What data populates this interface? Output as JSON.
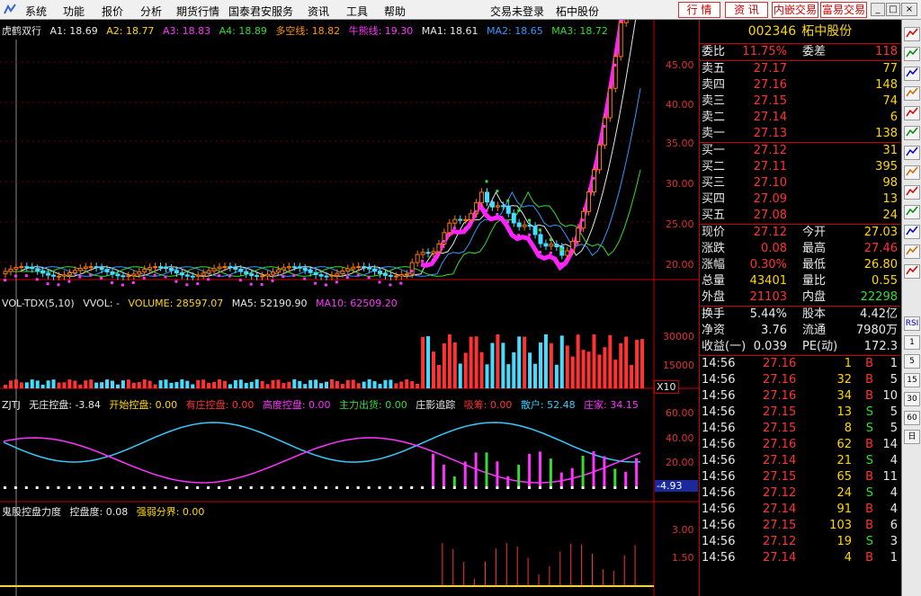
{
  "menu": {
    "items": [
      "系统",
      "功能",
      "报价",
      "分析",
      "期货行情",
      "国泰君安服务",
      "资讯",
      "工具",
      "帮助"
    ],
    "trade_status": "交易未登录",
    "stock_name": "柘中股份",
    "right_buttons": [
      "行 情",
      "资 讯",
      "内嵌交易",
      "富易交易"
    ],
    "window_buttons": [
      "_",
      "□",
      "×"
    ]
  },
  "chart": {
    "main_legend": {
      "title": "虎鹤双行",
      "items": [
        {
          "text": "A1: 18.69",
          "color": "#e8e8e8"
        },
        {
          "text": "A2: 18.77",
          "color": "#ffd800"
        },
        {
          "text": "A3: 18.83",
          "color": "#ff33ff"
        },
        {
          "text": "A4: 18.89",
          "color": "#33dd33"
        },
        {
          "text": "多空线: 18.82",
          "color": "#ff9900"
        },
        {
          "text": "牛熊线: 19.30",
          "color": "#ff33ff"
        },
        {
          "text": "MA1: 18.61",
          "color": "#e8e8e8"
        },
        {
          "text": "MA2: 18.65",
          "color": "#3399ff"
        },
        {
          "text": "MA3: 18.72",
          "color": "#33dd33"
        }
      ]
    },
    "price_ticks": [
      "45.00",
      "40.00",
      "35.00",
      "30.00",
      "25.00",
      "20.00"
    ],
    "vol_legend": {
      "items": [
        {
          "text": "VOL-TDX(5,10)",
          "color": "#e8e8e8"
        },
        {
          "text": "VVOL: -",
          "color": "#e8e8e8"
        },
        {
          "text": "VOLUME: 28597.07",
          "color": "#ffd800"
        },
        {
          "text": "MA5: 52190.90",
          "color": "#e8e8e8"
        },
        {
          "text": "MA10: 62509.20",
          "color": "#ff33ff"
        }
      ]
    },
    "vol_ticks": [
      "30000",
      "15000"
    ],
    "vol_unit": "X10",
    "zjtj_legend": {
      "items": [
        {
          "text": "ZJTJ",
          "color": "#e8e8e8"
        },
        {
          "text": "无庄控盘: -3.84",
          "color": "#e8e8e8"
        },
        {
          "text": "开始控盘: 0.00",
          "color": "#ffd800"
        },
        {
          "text": "有庄控盘: 0.00",
          "color": "#ff3333"
        },
        {
          "text": "高度控盘: 0.00",
          "color": "#ff33ff"
        },
        {
          "text": "主力出货: 0.00",
          "color": "#33dd33"
        },
        {
          "text": "庄影追踪",
          "color": "#e8e8e8"
        },
        {
          "text": "吸筹: 0.00",
          "color": "#ff3333"
        },
        {
          "text": "散户: 52.48",
          "color": "#33ccff"
        },
        {
          "text": "庄家: 34.15",
          "color": "#ff33ff"
        }
      ]
    },
    "zjtj_ticks": [
      "60.00",
      "40.00",
      "20.00"
    ],
    "zjtj_current": "-4.93",
    "ghost_legend": {
      "items": [
        {
          "text": "鬼股控盘力度",
          "color": "#e8e8e8"
        },
        {
          "text": "控盘度: 0.08",
          "color": "#e8e8e8"
        },
        {
          "text": "强弱分界: 0.00",
          "color": "#ffd800"
        }
      ]
    },
    "ghost_ticks": [
      "3.00",
      "1.50"
    ]
  },
  "quote": {
    "code": "002346",
    "name": "柘中股份",
    "commission_ratio": {
      "label": "委比",
      "value": "11.75%",
      "label2": "委差",
      "value2": "118"
    },
    "asks": [
      {
        "label": "卖五",
        "price": "27.17",
        "vol": "77"
      },
      {
        "label": "卖四",
        "price": "27.16",
        "vol": "148"
      },
      {
        "label": "卖三",
        "price": "27.15",
        "vol": "74"
      },
      {
        "label": "卖二",
        "price": "27.14",
        "vol": "6"
      },
      {
        "label": "卖一",
        "price": "27.13",
        "vol": "138"
      }
    ],
    "bids": [
      {
        "label": "买一",
        "price": "27.12",
        "vol": "31"
      },
      {
        "label": "买二",
        "price": "27.11",
        "vol": "395"
      },
      {
        "label": "买三",
        "price": "27.10",
        "vol": "98"
      },
      {
        "label": "买四",
        "price": "27.09",
        "vol": "13"
      },
      {
        "label": "买五",
        "price": "27.08",
        "vol": "24"
      }
    ],
    "stats1": [
      {
        "l1": "现价",
        "v1": "27.12",
        "c1": "#ff3333",
        "l2": "今开",
        "v2": "27.03",
        "c2": "#ffd800"
      },
      {
        "l1": "涨跌",
        "v1": "0.08",
        "c1": "#ff3333",
        "l2": "最高",
        "v2": "27.46",
        "c2": "#ff3333"
      },
      {
        "l1": "涨幅",
        "v1": "0.30%",
        "c1": "#ff3333",
        "l2": "最低",
        "v2": "26.80",
        "c2": "#ffd800"
      },
      {
        "l1": "总量",
        "v1": "43401",
        "c1": "#ffd800",
        "l2": "量比",
        "v2": "0.55",
        "c2": "#ffd800"
      },
      {
        "l1": "外盘",
        "v1": "21103",
        "c1": "#ff3333",
        "l2": "内盘",
        "v2": "22298",
        "c2": "#33dd33"
      }
    ],
    "stats2": [
      {
        "l1": "换手",
        "v1": "5.44%",
        "l2": "股本",
        "v2": "4.42亿"
      },
      {
        "l1": "净资",
        "v1": "3.76",
        "l2": "流通",
        "v2": "7980万"
      },
      {
        "l1": "收益(一)",
        "v1": "0.039",
        "l2": "PE(动)",
        "v2": "172.3"
      }
    ],
    "ticks": [
      {
        "time": "14:56",
        "price": "27.16",
        "vol": "1",
        "bs": "B",
        "n": "1"
      },
      {
        "time": "14:56",
        "price": "27.16",
        "vol": "32",
        "bs": "B",
        "n": "5"
      },
      {
        "time": "14:56",
        "price": "27.16",
        "vol": "34",
        "bs": "B",
        "n": "10"
      },
      {
        "time": "14:56",
        "price": "27.15",
        "vol": "13",
        "bs": "S",
        "n": "5"
      },
      {
        "time": "14:56",
        "price": "27.15",
        "vol": "8",
        "bs": "S",
        "n": "5"
      },
      {
        "time": "14:56",
        "price": "27.16",
        "vol": "62",
        "bs": "B",
        "n": "14"
      },
      {
        "time": "14:56",
        "price": "27.14",
        "vol": "21",
        "bs": "S",
        "n": "4"
      },
      {
        "time": "14:56",
        "price": "27.15",
        "vol": "65",
        "bs": "B",
        "n": "11"
      },
      {
        "time": "14:56",
        "price": "27.12",
        "vol": "24",
        "bs": "S",
        "n": "4"
      },
      {
        "time": "14:56",
        "price": "27.14",
        "vol": "91",
        "bs": "B",
        "n": "4"
      },
      {
        "time": "14:56",
        "price": "27.15",
        "vol": "103",
        "bs": "B",
        "n": "6"
      },
      {
        "time": "14:56",
        "price": "27.12",
        "vol": "19",
        "bs": "S",
        "n": "3"
      },
      {
        "time": "14:56",
        "price": "27.14",
        "vol": "4",
        "bs": "B",
        "n": "1"
      }
    ]
  },
  "toolbar": {
    "buttons": [
      "RSI",
      "1",
      "5",
      "15",
      "30",
      "60",
      "日"
    ]
  }
}
